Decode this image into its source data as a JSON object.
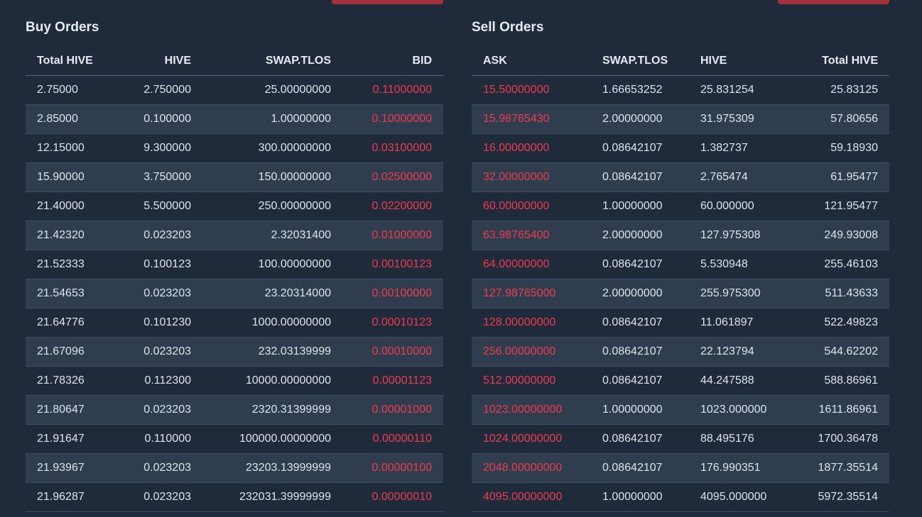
{
  "colors": {
    "background": "#1f2a3b",
    "row_alt": "#2f3d4f",
    "price_red": "#ee3c4e",
    "button_red": "#a3303b"
  },
  "buy": {
    "title": "Buy Orders",
    "columns": [
      "Total HIVE",
      "HIVE",
      "SWAP.TLOS",
      "BID"
    ],
    "rows": [
      [
        "2.75000",
        "2.750000",
        "25.00000000",
        "0.11000000"
      ],
      [
        "2.85000",
        "0.100000",
        "1.00000000",
        "0.10000000"
      ],
      [
        "12.15000",
        "9.300000",
        "300.00000000",
        "0.03100000"
      ],
      [
        "15.90000",
        "3.750000",
        "150.00000000",
        "0.02500000"
      ],
      [
        "21.40000",
        "5.500000",
        "250.00000000",
        "0.02200000"
      ],
      [
        "21.42320",
        "0.023203",
        "2.32031400",
        "0.01000000"
      ],
      [
        "21.52333",
        "0.100123",
        "100.00000000",
        "0.00100123"
      ],
      [
        "21.54653",
        "0.023203",
        "23.20314000",
        "0.00100000"
      ],
      [
        "21.64776",
        "0.101230",
        "1000.00000000",
        "0.00010123"
      ],
      [
        "21.67096",
        "0.023203",
        "232.03139999",
        "0.00010000"
      ],
      [
        "21.78326",
        "0.112300",
        "10000.00000000",
        "0.00001123"
      ],
      [
        "21.80647",
        "0.023203",
        "2320.31399999",
        "0.00001000"
      ],
      [
        "21.91647",
        "0.110000",
        "100000.00000000",
        "0.00000110"
      ],
      [
        "21.93967",
        "0.023203",
        "23203.13999999",
        "0.00000100"
      ],
      [
        "21.96287",
        "0.023203",
        "232031.39999999",
        "0.00000010"
      ]
    ]
  },
  "sell": {
    "title": "Sell Orders",
    "columns": [
      "ASK",
      "SWAP.TLOS",
      "HIVE",
      "Total HIVE"
    ],
    "rows": [
      [
        "15.50000000",
        "1.66653252",
        "25.831254",
        "25.83125"
      ],
      [
        "15.98765430",
        "2.00000000",
        "31.975309",
        "57.80656"
      ],
      [
        "16.00000000",
        "0.08642107",
        "1.382737",
        "59.18930"
      ],
      [
        "32.00000000",
        "0.08642107",
        "2.765474",
        "61.95477"
      ],
      [
        "60.00000000",
        "1.00000000",
        "60.000000",
        "121.95477"
      ],
      [
        "63.98765400",
        "2.00000000",
        "127.975308",
        "249.93008"
      ],
      [
        "64.00000000",
        "0.08642107",
        "5.530948",
        "255.46103"
      ],
      [
        "127.98765000",
        "2.00000000",
        "255.975300",
        "511.43633"
      ],
      [
        "128.00000000",
        "0.08642107",
        "11.061897",
        "522.49823"
      ],
      [
        "256.00000000",
        "0.08642107",
        "22.123794",
        "544.62202"
      ],
      [
        "512.00000000",
        "0.08642107",
        "44.247588",
        "588.86961"
      ],
      [
        "1023.00000000",
        "1.00000000",
        "1023.000000",
        "1611.86961"
      ],
      [
        "1024.00000000",
        "0.08642107",
        "88.495176",
        "1700.36478"
      ],
      [
        "2048.00000000",
        "0.08642107",
        "176.990351",
        "1877.35514"
      ],
      [
        "4095.00000000",
        "1.00000000",
        "4095.000000",
        "5972.35514"
      ]
    ]
  }
}
